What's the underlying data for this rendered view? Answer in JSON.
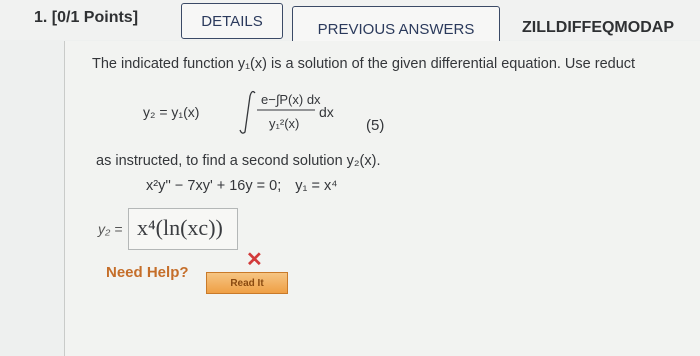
{
  "header": {
    "question_number": "1. [0/1 Points]",
    "details_label": "DETAILS",
    "previous_answers_label": "PREVIOUS ANSWERS",
    "course_code": "ZILLDIFFEQMODAP"
  },
  "problem": {
    "intro": "The indicated function y₁(x) is a solution of the given differential equation. Use reduct",
    "formula_lhs": "y₂ = y₁(x)",
    "formula_numerator": "e−∫P(x) dx",
    "formula_denominator": "y₁²(x)",
    "formula_dx": "dx",
    "equation_number": "(5)",
    "instruction": "as instructed, to find a second solution y₂(x).",
    "ode": "x²y'' − 7xy' + 16y = 0;",
    "given_solution": "y₁ = x⁴"
  },
  "answer": {
    "label": "y₂ =",
    "value": "x⁴(ln(xc))",
    "status": "incorrect"
  },
  "help": {
    "need_help_label": "Need Help?",
    "read_it_label": "Read It"
  },
  "colors": {
    "incorrect_mark": "#d23a3a",
    "help_text": "#c56e2a",
    "read_it_button": "#ef9f45"
  }
}
